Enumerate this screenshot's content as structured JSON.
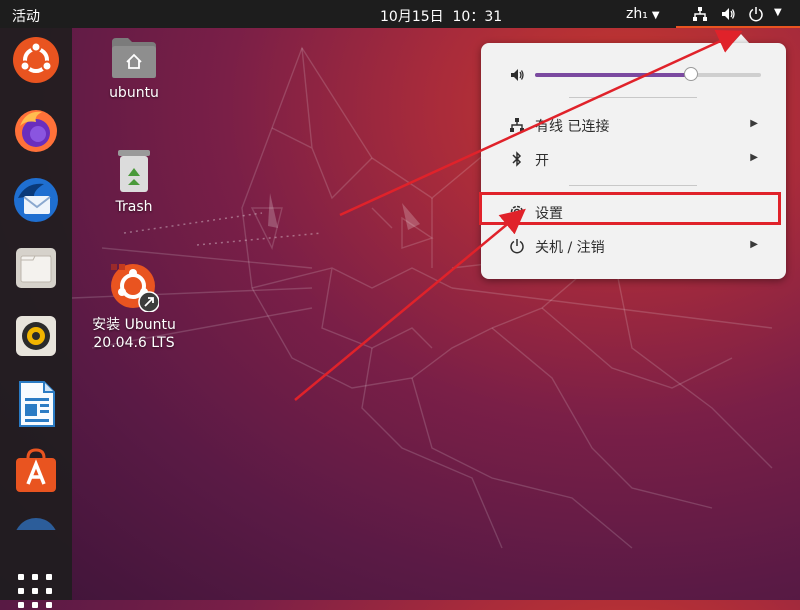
{
  "topbar": {
    "activities_label": "活动",
    "clock_label": "10月15日  10：31",
    "language_label": "zh₁"
  },
  "dock": {
    "items": [
      "ubuntu-logo-icon",
      "firefox-icon",
      "thunderbird-icon",
      "files-icon",
      "rhythmbox-icon",
      "libreoffice-writer-icon",
      "ubuntu-software-icon"
    ]
  },
  "desktop": {
    "icons": [
      {
        "label": "ubuntu",
        "icon": "home-folder-icon"
      },
      {
        "label": "Trash",
        "icon": "trash-icon"
      },
      {
        "label_line1": "安装 Ubuntu",
        "label_line2": "20.04.6 LTS",
        "icon": "ubuntu-installer-icon"
      }
    ]
  },
  "system_menu": {
    "volume_level": 0.69,
    "wired_label": "有线 已连接",
    "bluetooth_label": "开",
    "settings_label": "设置",
    "power_label": "关机 / 注销"
  },
  "colors": {
    "accent": "#e95420",
    "highlight_box": "#e0222a",
    "menu_bg": "#f2f2f2",
    "slider_fill": "#7b4aa0"
  }
}
